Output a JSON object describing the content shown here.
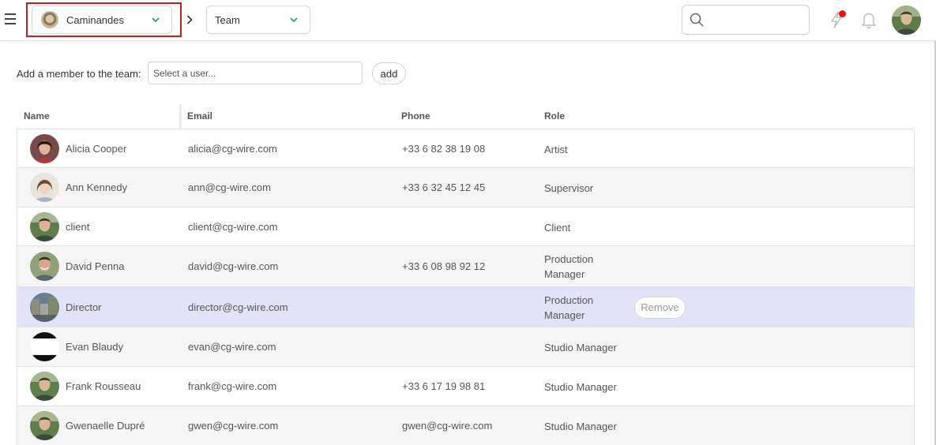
{
  "header": {
    "production": "Caminandes",
    "section": "Team",
    "search_placeholder": "",
    "colors": {
      "notification_dot": "#f01010",
      "chevron": "#1aa35a",
      "highlight_outline": "#d0191e"
    }
  },
  "add_member": {
    "label": "Add a member to the team:",
    "placeholder": "Select a user...",
    "button": "add"
  },
  "table": {
    "columns": {
      "name": "Name",
      "email": "Email",
      "phone": "Phone",
      "role": "Role"
    },
    "remove_label": "Remove",
    "rows": [
      {
        "name": "Alicia Cooper",
        "email": "alicia@cg-wire.com",
        "phone": "+33 6 82 38 19 08",
        "role1": "Artist",
        "role2": "",
        "avatar": "woman-dark"
      },
      {
        "name": "Ann Kennedy",
        "email": "ann@cg-wire.com",
        "phone": "+33 6 32 45 12 45",
        "role1": "Supervisor",
        "role2": "",
        "avatar": "woman-light"
      },
      {
        "name": "client",
        "email": "client@cg-wire.com",
        "phone": "",
        "role1": "Client",
        "role2": "",
        "avatar": "man-outdoor"
      },
      {
        "name": "David Penna",
        "email": "david@cg-wire.com",
        "phone": "+33 6 08 98 92 12",
        "role1": "Production",
        "role2": "Manager",
        "avatar": "man-smile"
      },
      {
        "name": "Director",
        "email": "director@cg-wire.com",
        "phone": "",
        "role1": "Production",
        "role2": "Manager",
        "avatar": "street"
      },
      {
        "name": "Evan Blaudy",
        "email": "evan@cg-wire.com",
        "phone": "",
        "role1": "Studio Manager",
        "role2": "",
        "avatar": "black-bar"
      },
      {
        "name": "Frank Rousseau",
        "email": "frank@cg-wire.com",
        "phone": "+33 6 17 19 98 81",
        "role1": "Studio Manager",
        "role2": "",
        "avatar": "man-outdoor"
      },
      {
        "name": "Gwenaelle Dupré",
        "email": "gwen@cg-wire.com",
        "phone": "gwen@cg-wire.com",
        "role1": "Studio Manager",
        "role2": "",
        "avatar": "man-outdoor"
      }
    ]
  }
}
